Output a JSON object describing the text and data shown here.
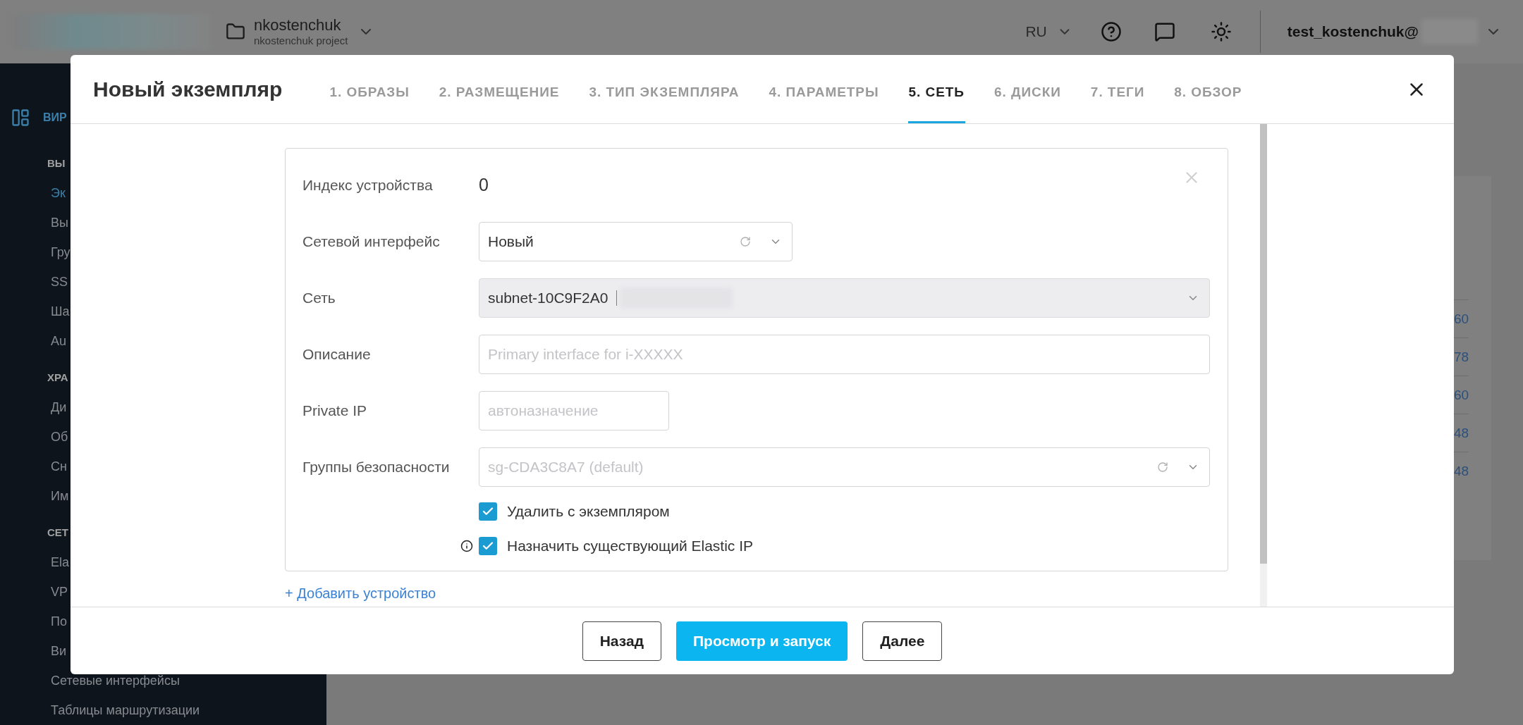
{
  "top_bar": {
    "project": {
      "name": "nkostenchuk",
      "subtitle": "nkostenchuk project"
    },
    "language": "RU",
    "user": "test_kostenchuk@"
  },
  "sidebar": {
    "title": "ВИР",
    "sections": [
      {
        "title": "ВЫ",
        "items": [
          {
            "label": "Эк",
            "selected": true
          },
          {
            "label": "Вы",
            "selected": false
          },
          {
            "label": "Гру",
            "selected": false
          },
          {
            "label": "SS",
            "selected": false
          },
          {
            "label": "Ша",
            "selected": false
          },
          {
            "label": "Au",
            "selected": false
          }
        ]
      },
      {
        "title": "ХРА",
        "items": [
          {
            "label": "Ди",
            "selected": false
          },
          {
            "label": "Об",
            "selected": false
          },
          {
            "label": "Сн",
            "selected": false
          },
          {
            "label": "Им",
            "selected": false
          }
        ]
      },
      {
        "title": "СЕТ",
        "items": [
          {
            "label": "Ela",
            "selected": false
          },
          {
            "label": "VP",
            "selected": false
          },
          {
            "label": "По",
            "selected": false
          },
          {
            "label": "Ви",
            "selected": false
          },
          {
            "label": "Сетевые интерфейсы",
            "selected": false
          },
          {
            "label": "Таблицы маршрутизации",
            "selected": false
          }
        ]
      }
    ]
  },
  "background_table": {
    "cells": [
      "60",
      "78",
      "60",
      "48",
      "48"
    ]
  },
  "modal": {
    "title": "Новый экземпляр",
    "tabs": [
      {
        "label": "1. ОБРАЗЫ",
        "selected": false
      },
      {
        "label": "2. РАЗМЕЩЕНИЕ",
        "selected": false
      },
      {
        "label": "3. ТИП ЭКЗЕМПЛЯРА",
        "selected": false
      },
      {
        "label": "4. ПАРАМЕТРЫ",
        "selected": false
      },
      {
        "label": "5. СЕТЬ",
        "selected": true
      },
      {
        "label": "6. ДИСКИ",
        "selected": false
      },
      {
        "label": "7. ТЕГИ",
        "selected": false
      },
      {
        "label": "8. ОБЗОР",
        "selected": false
      }
    ],
    "device": {
      "index_label": "Индекс устройства",
      "index_value": "0",
      "fields": [
        {
          "label": "Сетевой интерфейс",
          "kind": "select",
          "value": "Новый",
          "refresh": true,
          "readonly": false
        },
        {
          "label": "Сеть",
          "kind": "select",
          "value": "subnet-10C9F2A0",
          "redacted": true,
          "refresh": false,
          "readonly": true
        },
        {
          "label": "Описание",
          "kind": "text",
          "placeholder": "Primary interface for i-XXXXX"
        },
        {
          "label": "Private IP",
          "kind": "text",
          "placeholder": "автоназначение"
        },
        {
          "label": "Группы безопасности",
          "kind": "select",
          "placeholder": "sg-CDA3C8A7 (default)",
          "refresh": true,
          "readonly": false
        }
      ],
      "checkboxes": [
        {
          "label": "Удалить с экземпляром",
          "checked": true,
          "info": false
        },
        {
          "label": "Назначить существующий Elastic IP",
          "checked": true,
          "info": true
        }
      ]
    },
    "add_link": "+ Добавить устройство",
    "buttons": [
      {
        "label": "Назад",
        "kind": "secondary"
      },
      {
        "label": "Просмотр и запуск",
        "kind": "primary"
      },
      {
        "label": "Далее",
        "kind": "secondary"
      }
    ]
  }
}
